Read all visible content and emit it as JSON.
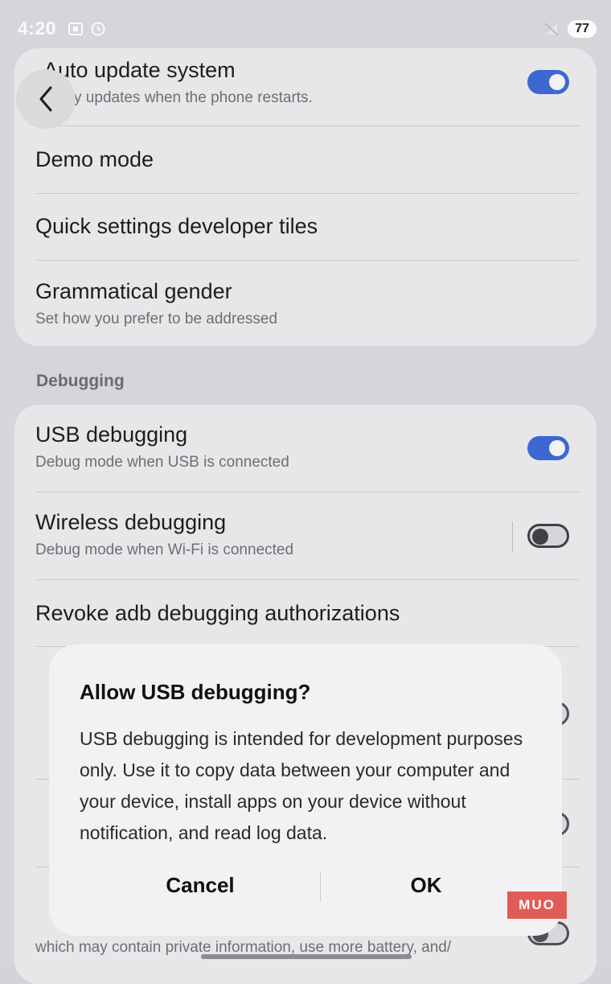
{
  "status_bar": {
    "time": "4:20",
    "battery": "77"
  },
  "settings": {
    "auto_update": {
      "title": "Auto update system",
      "subtitle": "Apply updates when the phone restarts.",
      "enabled": true
    },
    "demo_mode": {
      "title": "Demo mode"
    },
    "quick_tiles": {
      "title": "Quick settings developer tiles"
    },
    "grammatical_gender": {
      "title": "Grammatical gender",
      "subtitle": "Set how you prefer to be addressed"
    },
    "debugging_header": "Debugging",
    "usb_debugging": {
      "title": "USB debugging",
      "subtitle": "Debug mode when USB is connected",
      "enabled": true
    },
    "wireless_debugging": {
      "title": "Wireless debugging",
      "subtitle": "Debug mode when Wi-Fi is connected",
      "enabled": false
    },
    "revoke": {
      "title": "Revoke adb debugging authorizations"
    },
    "bottom_sub_line": "which may contain private information, use more battery, and/"
  },
  "dialog": {
    "title": "Allow USB debugging?",
    "body": "USB debugging is intended for development purposes only. Use it to copy data between your computer and your device, install apps on your device without notification, and read log data.",
    "cancel_label": "Cancel",
    "ok_label": "OK"
  },
  "watermark": "MUO",
  "colors": {
    "toggle_on": "#3d67d1",
    "card": "#e7e7ea",
    "dialog": "#f2f2f4"
  }
}
